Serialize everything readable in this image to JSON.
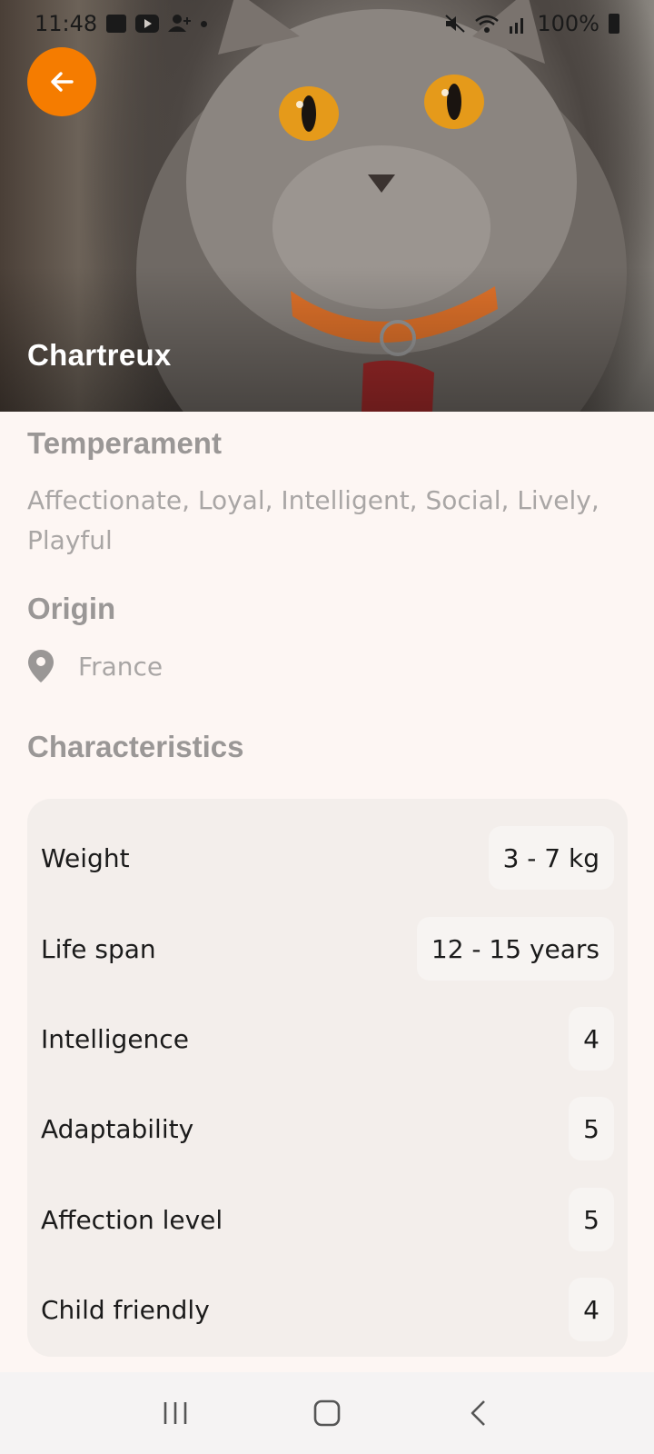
{
  "status_bar": {
    "time": "11:48",
    "battery": "100%"
  },
  "hero": {
    "title": "Chartreux",
    "image_alt": "Chartreux cat photo"
  },
  "temperament": {
    "heading": "Temperament",
    "text": "Affectionate, Loyal, Intelligent, Social, Lively, Playful"
  },
  "origin": {
    "heading": "Origin",
    "country": "France",
    "icon": "location-pin-icon"
  },
  "characteristics": {
    "heading": "Characteristics",
    "rows": [
      {
        "label": "Weight",
        "value": "3 - 7 kg"
      },
      {
        "label": "Life span",
        "value": "12 - 15 years"
      },
      {
        "label": "Intelligence",
        "value": "4"
      },
      {
        "label": "Adaptability",
        "value": "5"
      },
      {
        "label": "Affection level",
        "value": "5"
      },
      {
        "label": "Child friendly",
        "value": "4"
      }
    ]
  },
  "colors": {
    "accent": "#f57c00",
    "background": "#fdf6f3",
    "card": "#f3eeeb",
    "heading": "#9a9796",
    "muted_text": "#a9a6a5"
  }
}
